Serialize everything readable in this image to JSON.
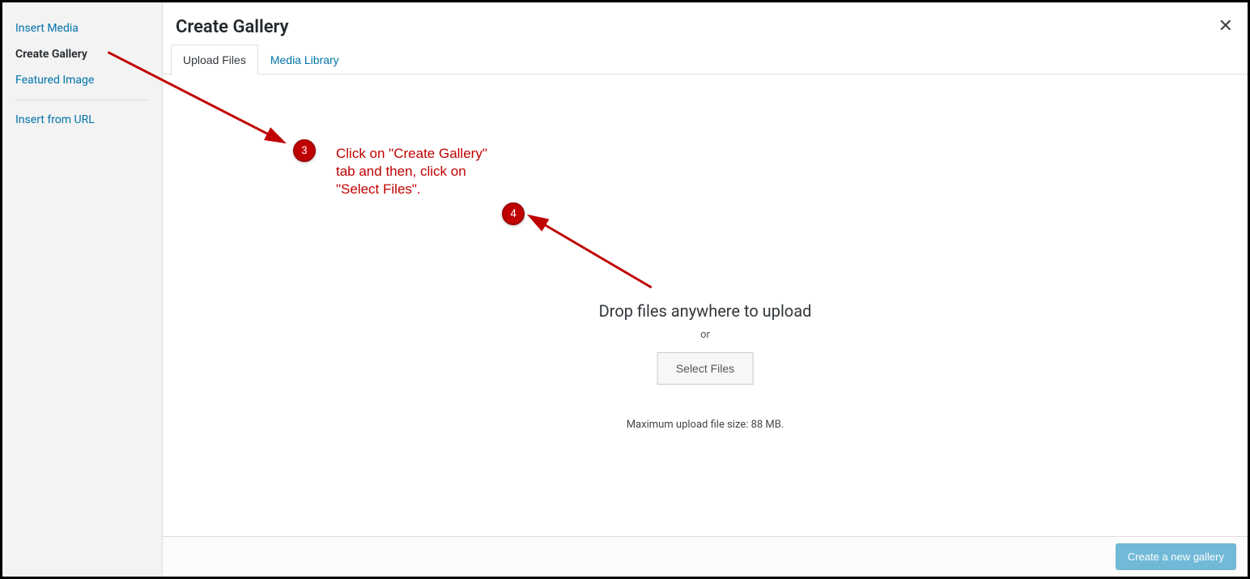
{
  "sidebar": {
    "items": [
      {
        "label": "Insert Media",
        "active": false
      },
      {
        "label": "Create Gallery",
        "active": true
      },
      {
        "label": "Featured Image",
        "active": false
      }
    ],
    "url_item": "Insert from URL"
  },
  "header": {
    "title": "Create Gallery"
  },
  "tabs": [
    {
      "label": "Upload Files",
      "active": true
    },
    {
      "label": "Media Library",
      "active": false
    }
  ],
  "upload": {
    "drop_text": "Drop files anywhere to upload",
    "or_text": "or",
    "button_label": "Select Files",
    "max_text": "Maximum upload file size: 88 MB."
  },
  "footer": {
    "primary_label": "Create a new gallery"
  },
  "annotations": {
    "step3": "3",
    "step4": "4",
    "note": "Click on  \"Create Gallery\" tab and then, click on \"Select Files\"."
  }
}
